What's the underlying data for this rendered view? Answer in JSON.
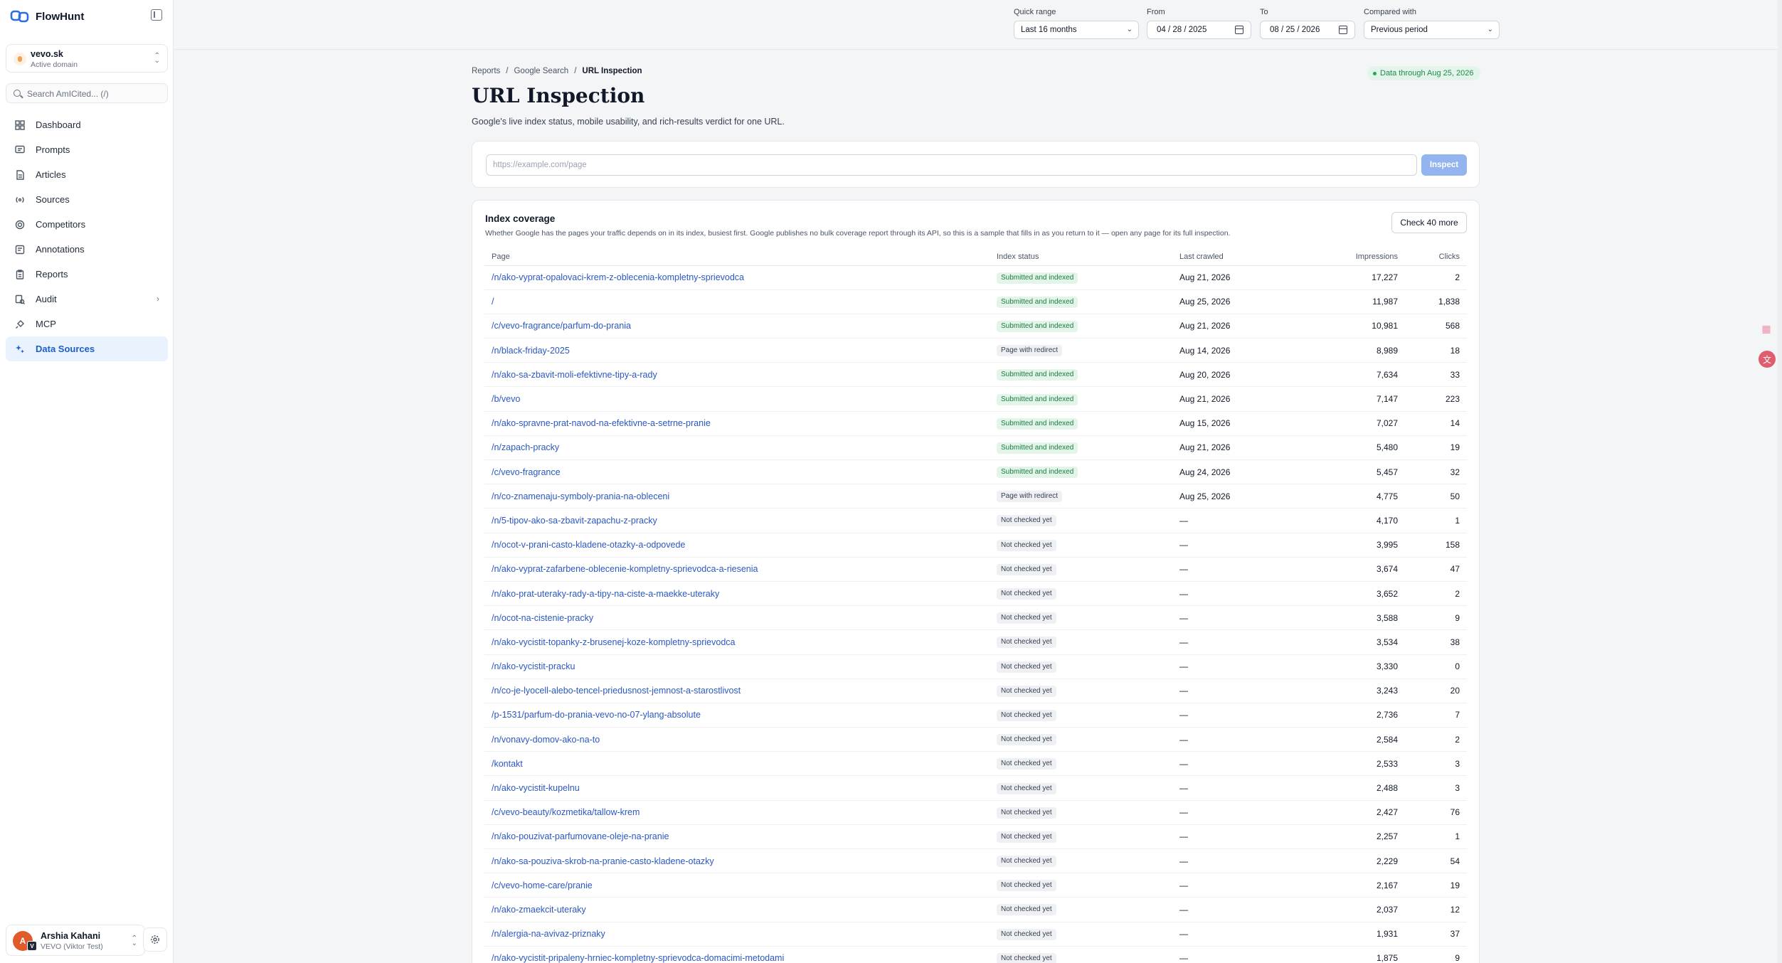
{
  "app": {
    "name": "FlowHunt"
  },
  "domain": {
    "name": "vevo.sk",
    "subtitle": "Active domain"
  },
  "search": {
    "placeholder": "Search AmICited... (/)"
  },
  "nav": [
    {
      "label": "Dashboard",
      "icon": "grid-icon"
    },
    {
      "label": "Prompts",
      "icon": "chat-icon"
    },
    {
      "label": "Articles",
      "icon": "document-icon"
    },
    {
      "label": "Sources",
      "icon": "broadcast-icon"
    },
    {
      "label": "Competitors",
      "icon": "target-icon"
    },
    {
      "label": "Annotations",
      "icon": "note-icon"
    },
    {
      "label": "Reports",
      "icon": "clipboard-icon"
    },
    {
      "label": "Audit",
      "icon": "audit-icon"
    },
    {
      "label": "MCP",
      "icon": "plug-icon"
    },
    {
      "label": "Data Sources",
      "icon": "sparkle-icon"
    }
  ],
  "user": {
    "name": "Arshia Kahani",
    "org": "VEVO (Viktor Test)",
    "initial": "A",
    "badge": "V"
  },
  "filters": {
    "quick_range_label": "Quick range",
    "quick_range_value": "Last 16 months",
    "from_label": "From",
    "from_value": "04 / 28 / 2025",
    "to_label": "To",
    "to_value": "08 / 25 / 2026",
    "compared_label": "Compared with",
    "compared_value": "Previous period"
  },
  "breadcrumb": [
    "Reports",
    "/",
    "Google Search",
    "/",
    "URL Inspection"
  ],
  "data_badge": "Data through Aug 25, 2026",
  "page": {
    "title": "URL Inspection",
    "subtitle": "Google's live index status, mobile usability, and rich-results verdict for one URL."
  },
  "inspect": {
    "placeholder": "https://example.com/page",
    "button": "Inspect"
  },
  "coverage": {
    "title": "Index coverage",
    "description": "Whether Google has the pages your traffic depends on in its index, busiest first. Google publishes no bulk coverage report through its API, so this is a sample that fills in as you return to it — open any page for its full inspection.",
    "check_button": "Check 40 more",
    "columns": [
      "Page",
      "Index status",
      "Last crawled",
      "Impressions",
      "Clicks"
    ],
    "rows": [
      {
        "page": "/n/ako-vyprat-opalovaci-krem-z-oblecenia-kompletny-sprievodca",
        "status": "Submitted and indexed",
        "tone": "green",
        "crawled": "Aug 21, 2026",
        "impressions": "17,227",
        "clicks": "2"
      },
      {
        "page": "/",
        "status": "Submitted and indexed",
        "tone": "green",
        "crawled": "Aug 25, 2026",
        "impressions": "11,987",
        "clicks": "1,838"
      },
      {
        "page": "/c/vevo-fragrance/parfum-do-prania",
        "status": "Submitted and indexed",
        "tone": "green",
        "crawled": "Aug 21, 2026",
        "impressions": "10,981",
        "clicks": "568"
      },
      {
        "page": "/n/black-friday-2025",
        "status": "Page with redirect",
        "tone": "gray",
        "crawled": "Aug 14, 2026",
        "impressions": "8,989",
        "clicks": "18"
      },
      {
        "page": "/n/ako-sa-zbavit-moli-efektivne-tipy-a-rady",
        "status": "Submitted and indexed",
        "tone": "green",
        "crawled": "Aug 20, 2026",
        "impressions": "7,634",
        "clicks": "33"
      },
      {
        "page": "/b/vevo",
        "status": "Submitted and indexed",
        "tone": "green",
        "crawled": "Aug 21, 2026",
        "impressions": "7,147",
        "clicks": "223"
      },
      {
        "page": "/n/ako-spravne-prat-navod-na-efektivne-a-setrne-pranie",
        "status": "Submitted and indexed",
        "tone": "green",
        "crawled": "Aug 15, 2026",
        "impressions": "7,027",
        "clicks": "14"
      },
      {
        "page": "/n/zapach-pracky",
        "status": "Submitted and indexed",
        "tone": "green",
        "crawled": "Aug 21, 2026",
        "impressions": "5,480",
        "clicks": "19"
      },
      {
        "page": "/c/vevo-fragrance",
        "status": "Submitted and indexed",
        "tone": "green",
        "crawled": "Aug 24, 2026",
        "impressions": "5,457",
        "clicks": "32"
      },
      {
        "page": "/n/co-znamenaju-symboly-prania-na-obleceni",
        "status": "Page with redirect",
        "tone": "gray",
        "crawled": "Aug 25, 2026",
        "impressions": "4,775",
        "clicks": "50"
      },
      {
        "page": "/n/5-tipov-ako-sa-zbavit-zapachu-z-pracky",
        "status": "Not checked yet",
        "tone": "gray",
        "crawled": "—",
        "impressions": "4,170",
        "clicks": "1"
      },
      {
        "page": "/n/ocot-v-prani-casto-kladene-otazky-a-odpovede",
        "status": "Not checked yet",
        "tone": "gray",
        "crawled": "—",
        "impressions": "3,995",
        "clicks": "158"
      },
      {
        "page": "/n/ako-vyprat-zafarbene-oblecenie-kompletny-sprievodca-a-riesenia",
        "status": "Not checked yet",
        "tone": "gray",
        "crawled": "—",
        "impressions": "3,674",
        "clicks": "47"
      },
      {
        "page": "/n/ako-prat-uteraky-rady-a-tipy-na-ciste-a-maekke-uteraky",
        "status": "Not checked yet",
        "tone": "gray",
        "crawled": "—",
        "impressions": "3,652",
        "clicks": "2"
      },
      {
        "page": "/n/ocot-na-cistenie-pracky",
        "status": "Not checked yet",
        "tone": "gray",
        "crawled": "—",
        "impressions": "3,588",
        "clicks": "9"
      },
      {
        "page": "/n/ako-vycistit-topanky-z-brusenej-koze-kompletny-sprievodca",
        "status": "Not checked yet",
        "tone": "gray",
        "crawled": "—",
        "impressions": "3,534",
        "clicks": "38"
      },
      {
        "page": "/n/ako-vycistit-pracku",
        "status": "Not checked yet",
        "tone": "gray",
        "crawled": "—",
        "impressions": "3,330",
        "clicks": "0"
      },
      {
        "page": "/n/co-je-lyocell-alebo-tencel-priedusnost-jemnost-a-starostlivost",
        "status": "Not checked yet",
        "tone": "gray",
        "crawled": "—",
        "impressions": "3,243",
        "clicks": "20"
      },
      {
        "page": "/p-1531/parfum-do-prania-vevo-no-07-ylang-absolute",
        "status": "Not checked yet",
        "tone": "gray",
        "crawled": "—",
        "impressions": "2,736",
        "clicks": "7"
      },
      {
        "page": "/n/vonavy-domov-ako-na-to",
        "status": "Not checked yet",
        "tone": "gray",
        "crawled": "—",
        "impressions": "2,584",
        "clicks": "2"
      },
      {
        "page": "/kontakt",
        "status": "Not checked yet",
        "tone": "gray",
        "crawled": "—",
        "impressions": "2,533",
        "clicks": "3"
      },
      {
        "page": "/n/ako-vycistit-kupelnu",
        "status": "Not checked yet",
        "tone": "gray",
        "crawled": "—",
        "impressions": "2,488",
        "clicks": "3"
      },
      {
        "page": "/c/vevo-beauty/kozmetika/tallow-krem",
        "status": "Not checked yet",
        "tone": "gray",
        "crawled": "—",
        "impressions": "2,427",
        "clicks": "76"
      },
      {
        "page": "/n/ako-pouzivat-parfumovane-oleje-na-pranie",
        "status": "Not checked yet",
        "tone": "gray",
        "crawled": "—",
        "impressions": "2,257",
        "clicks": "1"
      },
      {
        "page": "/n/ako-sa-pouziva-skrob-na-pranie-casto-kladene-otazky",
        "status": "Not checked yet",
        "tone": "gray",
        "crawled": "—",
        "impressions": "2,229",
        "clicks": "54"
      },
      {
        "page": "/c/vevo-home-care/pranie",
        "status": "Not checked yet",
        "tone": "gray",
        "crawled": "—",
        "impressions": "2,167",
        "clicks": "19"
      },
      {
        "page": "/n/ako-zmaekcit-uteraky",
        "status": "Not checked yet",
        "tone": "gray",
        "crawled": "—",
        "impressions": "2,037",
        "clicks": "12"
      },
      {
        "page": "/n/alergia-na-avivaz-priznaky",
        "status": "Not checked yet",
        "tone": "gray",
        "crawled": "—",
        "impressions": "1,931",
        "clicks": "37"
      },
      {
        "page": "/n/ako-vycistit-pripaleny-hrniec-kompletny-sprievodca-domacimi-metodami",
        "status": "Not checked yet",
        "tone": "gray",
        "crawled": "—",
        "impressions": "1,875",
        "clicks": "9"
      }
    ]
  },
  "colors": {
    "accent": "#1d5fc8",
    "link": "#2b57c4",
    "success": "#1f8a4c",
    "inspect_button": "#93b4ee"
  }
}
